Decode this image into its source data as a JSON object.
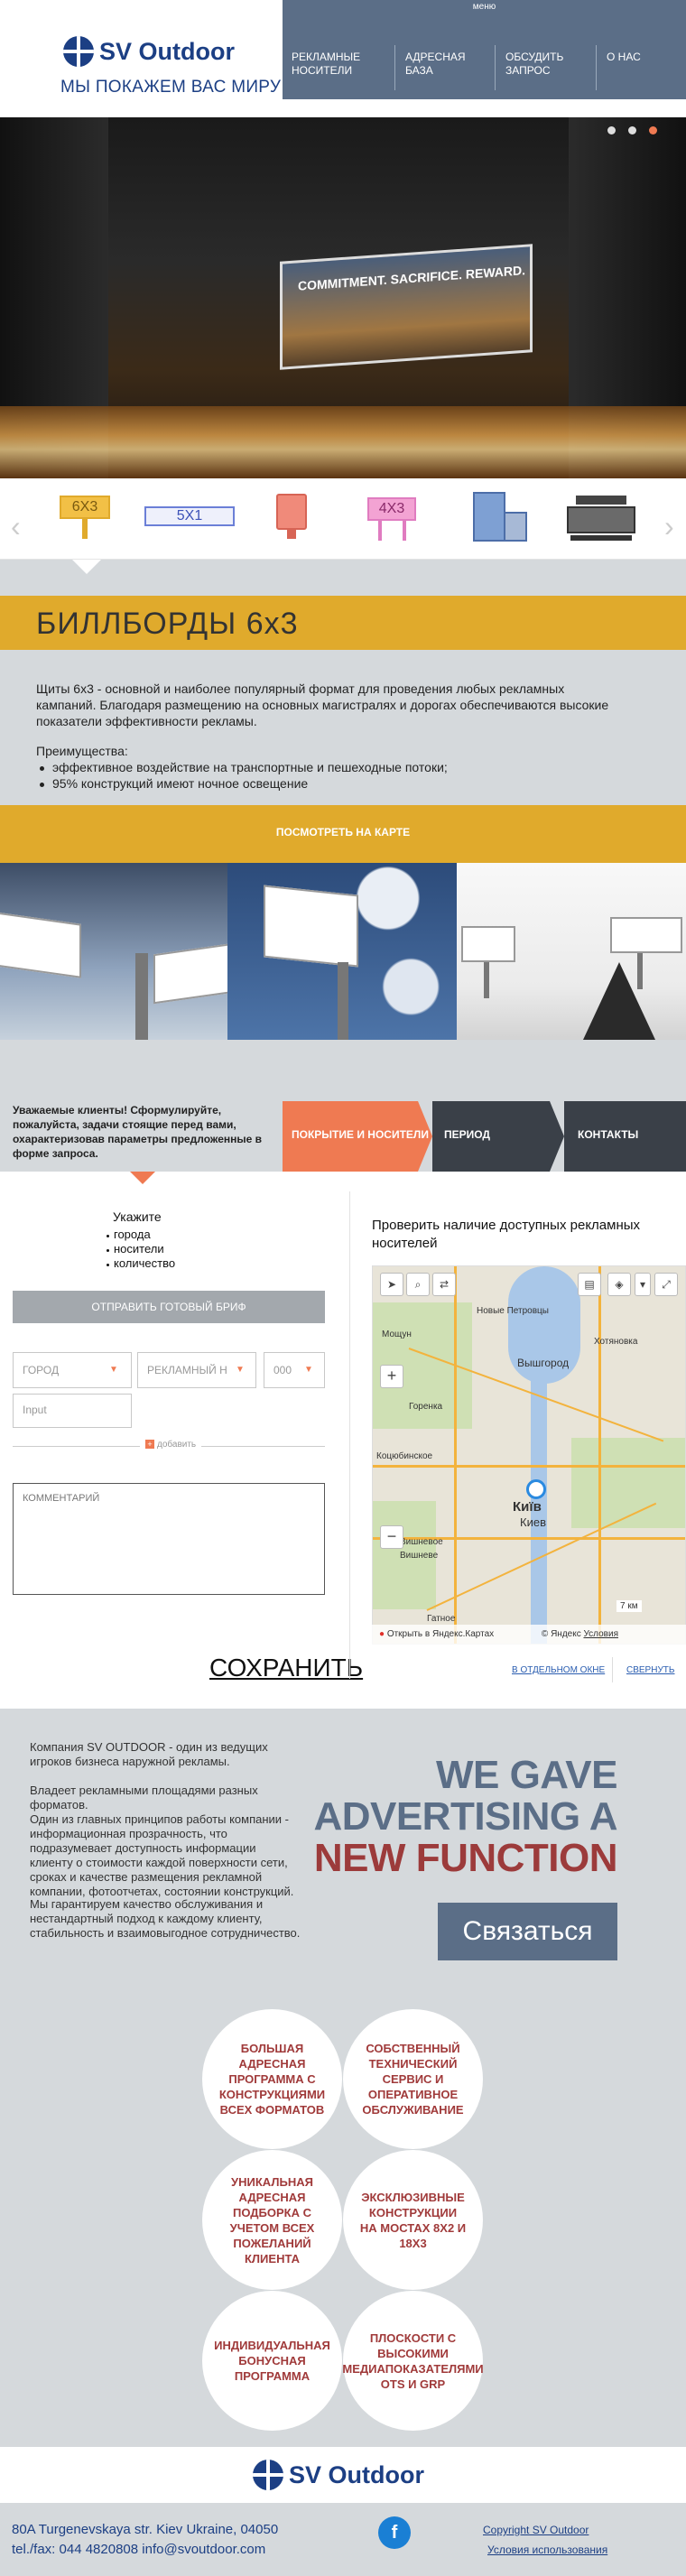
{
  "header": {
    "logo_text": "SV Outdoor",
    "tagline": "МЫ ПОКАЖЕМ ВАС МИРУ",
    "menu_label": "меню",
    "nav": [
      "РЕКЛАМНЫЕ НОСИТЕЛИ",
      "АДРЕСНАЯ БАЗА",
      "ОБСУДИТЬ ЗАПРОС",
      "О НАС"
    ]
  },
  "hero": {
    "billboard_text": "COMMITMENT. SACRIFICE. REWARD.",
    "slider_dot_count": 3
  },
  "formats": {
    "items": [
      "6X3",
      "5X1",
      "citylight-icon",
      "4X3",
      "lightbox-icon",
      "bus-icon"
    ],
    "selected": "6X3"
  },
  "format_page": {
    "title": "БИЛЛБОРДЫ 6x3",
    "description": "Щиты 6x3 - основной и наиболее популярный формат для проведения любых рекламных кампаний. Благодаря размещению на основных магистралях и дорогах обеспечиваются высокие показатели эффективности рекламы.",
    "advantages_heading": "Преимущества:",
    "advantages": [
      "эффективное воздействие на транспортные и пешеходные потоки;",
      "95% конструкций имеют ночное освещение"
    ],
    "map_button": "ПОСМОТРЕТЬ НА КАРТЕ"
  },
  "brief": {
    "intro": "Уважаемые клиенты! Сформулируйте, пожалуйста, задачи стоящие перед вами, охарактеризовав параметры предложенные в форме запроса.",
    "tabs": [
      "ПОКРЫТИЕ И НОСИТЕЛИ",
      "ПЕРИОД",
      "КОНТАКТЫ"
    ],
    "form_heading": "Укажите",
    "form_items": [
      "города",
      "носители",
      "количество"
    ],
    "send_button": "ОТПРАВИТЬ ГОТОВЫЙ БРИФ",
    "select_city": "ГОРОД",
    "select_media": "РЕКЛАМНЫЙ Н",
    "select_qty": "000",
    "input_placeholder": "Input",
    "add_label": "добавить",
    "comment_placeholder": "КОММЕНТАРИЙ",
    "save_label": "СОХРАНИТЬ"
  },
  "map": {
    "title": "Проверить наличие доступных рекламных носителей",
    "city_label": "Київ",
    "city_label2": "Киев",
    "labels": [
      "Вышгород",
      "Новые Петровцы",
      "Хотяновка",
      "Мощун",
      "Горенка",
      "Коцюбинское",
      "Вишневое",
      "Вишневе",
      "Гатное"
    ],
    "scale": "7 км",
    "open_yandex": "Открыть в Яндекс.Картах",
    "copyright": "© Яндекс",
    "terms": "Условия",
    "open_new_window": "В ОТДЕЛЬНОМ ОКНЕ",
    "collapse": "СВЕРНУТЬ"
  },
  "about": {
    "paragraphs": [
      "Компания SV OUTDOOR - один из ведущих игроков бизнеса наружной рекламы.",
      "Владеет рекламными площадями разных форматов.",
      "Один из главных принципов работы компании - информационная прозрачность, что подразумевает доступность информации клиенту о стоимости каждой поверхности сети, сроках и качестве размещения рекламной компании, фотоотчетах, состоянии конструкций.",
      "Мы гарантируем качество обслуживания и нестандартный подход к каждому клиенту, стабильность и взаимовыгодное сотрудничество."
    ],
    "headline": [
      "WE GAVE",
      "ADVERTISING A",
      "NEW FUNCTION"
    ],
    "headline_colors": [
      "#5b6e87",
      "#5b6e87",
      "#9c3b3b"
    ],
    "contact_button": "Связаться",
    "circles": [
      "БОЛЬШАЯ АДРЕСНАЯ ПРОГРАММА С КОНСТРУКЦИЯМИ ВСЕХ ФОРМАТОВ",
      "СОБСТВЕННЫЙ ТЕХНИЧЕСКИЙ СЕРВИС И ОПЕРАТИВНОЕ ОБСЛУЖИВАНИЕ",
      "УНИКАЛЬНАЯ АДРЕСНАЯ ПОДБОРКА С УЧЕТОМ ВСЕХ ПОЖЕЛАНИЙ КЛИЕНТА",
      "ЭКСКЛЮЗИВНЫЕ КОНСТРУКЦИИ НА МОСТАХ 8Х2 И 18Х3",
      "ИНДИВИДУАЛЬНАЯ БОНУСНАЯ ПРОГРАММА",
      "ПЛОСКОСТИ С ВЫСОКИМИ МЕДИАПОКАЗАТЕЛЯМИ OTS И GRP"
    ]
  },
  "footer": {
    "logo_text": "SV Outdoor",
    "address": "80A Turgenevskaya str. Kiev Ukraine, 04050",
    "phone_email": "tel./fax: 044 4820808 info@svoutdoor.com",
    "copyright": "Copyright SV Outdoor",
    "terms": "Условия использования"
  },
  "colors": {
    "brand_blue": "#1c3f84",
    "accent_yellow": "#e0aa2c",
    "accent_orange": "#ef7a52",
    "slate": "#5b6e87",
    "red": "#9c3b3b"
  }
}
